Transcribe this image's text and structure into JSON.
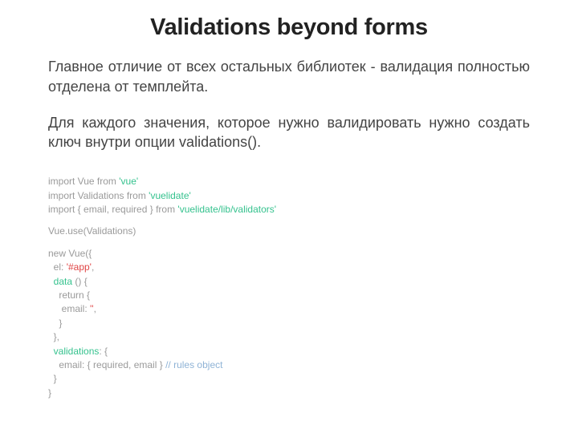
{
  "title": "Validations beyond forms",
  "paragraphs": {
    "p1": "Главное отличие от всех остальных библиотек - валидация полностью отделена от темплейта.",
    "p2": "Для каждого значения, которое нужно валидировать нужно создать ключ внутри опции validations()."
  },
  "code": {
    "l1_a": "import",
    "l1_b": " Vue ",
    "l1_c": "from",
    "l1_d": " 'vue'",
    "l2_a": "import",
    "l2_b": " Validations ",
    "l2_c": "from",
    "l2_d": " 'vuelidate'",
    "l3_a": "import",
    "l3_b": " { email, required } ",
    "l3_c": "from",
    "l3_d": " 'vuelidate/lib/validators'",
    "l4": "Vue.use(Validations)",
    "l5_a": "new",
    "l5_b": " Vue({",
    "l6_a": "  el: ",
    "l6_b": "'#app'",
    "l6_c": ",",
    "l7_a": "  ",
    "l7_b": "data",
    "l7_c": " () {",
    "l8": "    return {",
    "l9_a": "     email: ",
    "l9_b": "''",
    "l9_c": ",",
    "l10": "    }",
    "l11": "  },",
    "l12_a": "  ",
    "l12_b": "validations",
    "l12_c": ": {",
    "l13_a": "    email: { required, email } ",
    "l13_b": "// rules object",
    "l14": "  }",
    "l15": "}"
  }
}
